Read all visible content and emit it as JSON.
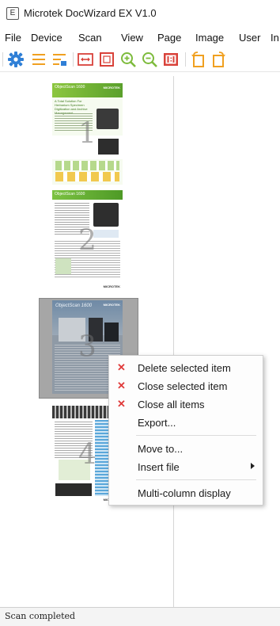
{
  "window": {
    "title": "Microtek DocWizard EX V1.0",
    "icon_glyph": "E"
  },
  "menu": [
    "File",
    "Device",
    "Scan",
    "View",
    "Page",
    "Image",
    "User",
    "In"
  ],
  "thumbnails": [
    {
      "label": "1",
      "heading": "ObjectScan 1600",
      "subheading": "A Total Solution For Herbarium Specimen Digitization and Archive Management",
      "brand": "MICROTEK"
    },
    {
      "label": "2",
      "heading": "ObjectScan 1600",
      "brand": "MICROTEK"
    },
    {
      "label": "3",
      "heading": "ObjectScan 1600",
      "brand": "MICROTEK"
    },
    {
      "label": "4",
      "brand": "MICROTEK"
    }
  ],
  "context_menu": {
    "items": [
      {
        "label": "Delete selected item",
        "icon": "x"
      },
      {
        "label": "Close selected item",
        "icon": "x"
      },
      {
        "label": "Close all items",
        "icon": "x"
      },
      {
        "label": "Export..."
      },
      {
        "label": "Move to..."
      },
      {
        "label": "Insert file",
        "submenu": true
      },
      {
        "label": "Multi-column display"
      }
    ]
  },
  "status": {
    "text": "Scan completed"
  },
  "colors": {
    "accent_blue": "#2f7fd6",
    "accent_green": "#7dbb3c",
    "accent_red": "#d9423a",
    "accent_orange": "#f0a020",
    "x_red": "#e03b3b"
  }
}
